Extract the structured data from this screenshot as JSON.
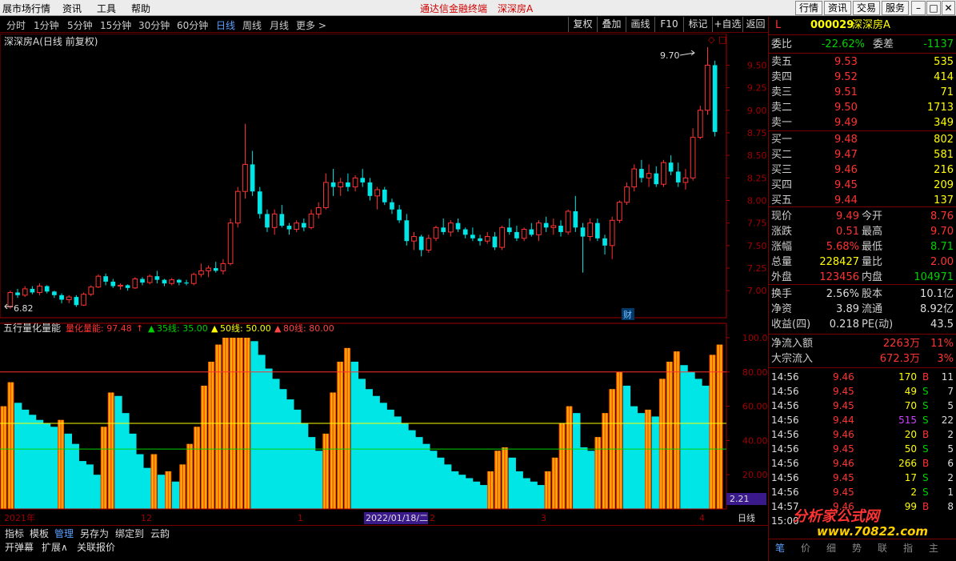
{
  "menubar": {
    "market_label": "展市场行情",
    "info_label": "资讯",
    "tools_label": "工具",
    "help_label": "帮助",
    "app_title": "通达信金融终端",
    "stock_title": "深深房A",
    "quote_btn": "行情",
    "news_btn": "资讯",
    "trade_btn": "交易",
    "service_btn": "服务"
  },
  "periods": [
    "分时",
    "1分钟",
    "5分钟",
    "15分钟",
    "30分钟",
    "60分钟",
    "日线",
    "周线",
    "月线",
    "更多 >"
  ],
  "toolbar": [
    "复权",
    "叠加",
    "画线",
    "F10",
    "标记",
    "+自选",
    "返回"
  ],
  "price_chart": {
    "title": "深深房A(日线 前复权)",
    "high_label": "9.70",
    "low_label": "6.82",
    "cai_label": "财",
    "axis_ticks": [
      "9.50",
      "9.25",
      "9.00",
      "8.75",
      "8.50",
      "8.25",
      "8.00",
      "7.75",
      "7.50",
      "7.25",
      "7.00"
    ]
  },
  "indicator": {
    "name": "五行量化量能",
    "series1": "量化量能: 97.48",
    "series2": "35线: 35.00",
    "series3": "50线: 50.00",
    "series4": "80线: 80.00",
    "axis_ticks": [
      "100.00",
      "80.00",
      "60.00",
      "40.00",
      "20.00"
    ],
    "cursor_value": "2.21"
  },
  "date_axis": {
    "year_label": "2021年",
    "m12": "12",
    "m1": "1",
    "date_box": "2022/01/18/二",
    "m2": "2",
    "m3": "3",
    "m4": "4",
    "period_label": "日线"
  },
  "quote": {
    "prefix": "L",
    "code": "000029",
    "name": "深深房A",
    "wb_label": "委比",
    "wb_value": "-22.62%",
    "wc_label": "委差",
    "wc_value": "-1137",
    "asks": [
      {
        "label": "卖五",
        "price": "9.53",
        "vol": "535"
      },
      {
        "label": "卖四",
        "price": "9.52",
        "vol": "414"
      },
      {
        "label": "卖三",
        "price": "9.51",
        "vol": "71"
      },
      {
        "label": "卖二",
        "price": "9.50",
        "vol": "1713"
      },
      {
        "label": "卖一",
        "price": "9.49",
        "vol": "349"
      }
    ],
    "bids": [
      {
        "label": "买一",
        "price": "9.48",
        "vol": "802"
      },
      {
        "label": "买二",
        "price": "9.47",
        "vol": "581"
      },
      {
        "label": "买三",
        "price": "9.46",
        "vol": "216"
      },
      {
        "label": "买四",
        "price": "9.45",
        "vol": "209"
      },
      {
        "label": "买五",
        "price": "9.44",
        "vol": "137"
      }
    ],
    "stats": [
      {
        "l1": "现价",
        "v1": "9.49",
        "l2": "今开",
        "v2": "8.76"
      },
      {
        "l1": "涨跌",
        "v1": "0.51",
        "l2": "最高",
        "v2": "9.70"
      },
      {
        "l1": "涨幅",
        "v1": "5.68%",
        "l2": "最低",
        "v2": "8.71"
      },
      {
        "l1": "总量",
        "v1": "228427",
        "l2": "量比",
        "v2": "2.00"
      },
      {
        "l1": "外盘",
        "v1": "123456",
        "l2": "内盘",
        "v2": "104971"
      }
    ],
    "stats2": [
      {
        "l1": "换手",
        "v1": "2.56%",
        "l2": "股本",
        "v2": "10.1亿"
      },
      {
        "l1": "净资",
        "v1": "3.89",
        "l2": "流通",
        "v2": "8.92亿"
      },
      {
        "l1": "收益(四)",
        "v1": "0.218",
        "l2": "PE(动)",
        "v2": "43.5"
      }
    ],
    "flow": [
      {
        "l": "净流入额",
        "v": "2263万",
        "p": "11%"
      },
      {
        "l": "大宗流入",
        "v": "672.3万",
        "p": "3%"
      }
    ],
    "ticks": [
      {
        "t": "14:56",
        "p": "9.46",
        "v": "170",
        "d": "B",
        "n": "11"
      },
      {
        "t": "14:56",
        "p": "9.45",
        "v": "49",
        "d": "S",
        "n": "7"
      },
      {
        "t": "14:56",
        "p": "9.45",
        "v": "70",
        "d": "S",
        "n": "5"
      },
      {
        "t": "14:56",
        "p": "9.44",
        "v": "515",
        "d": "S",
        "n": "22"
      },
      {
        "t": "14:56",
        "p": "9.46",
        "v": "20",
        "d": "B",
        "n": "2"
      },
      {
        "t": "14:56",
        "p": "9.45",
        "v": "50",
        "d": "S",
        "n": "5"
      },
      {
        "t": "14:56",
        "p": "9.46",
        "v": "266",
        "d": "B",
        "n": "6"
      },
      {
        "t": "14:56",
        "p": "9.45",
        "v": "17",
        "d": "S",
        "n": "2"
      },
      {
        "t": "14:56",
        "p": "9.45",
        "v": "2",
        "d": "S",
        "n": "1"
      },
      {
        "t": "14:57",
        "p": "9.46",
        "v": "99",
        "d": "B",
        "n": "8"
      },
      {
        "t": "15:00",
        "p": "",
        "v": "",
        "d": "",
        "n": ""
      }
    ],
    "bottom_tabs": [
      "笔",
      "价",
      "细",
      "势",
      "联",
      "指",
      "主"
    ]
  },
  "bottom": {
    "row1": [
      "指标",
      "模板",
      "管理",
      "另存为",
      "绑定到",
      "云韵"
    ],
    "row2": [
      "开弹幕",
      "扩展∧",
      "关联报价"
    ]
  },
  "watermark": {
    "text1": "分析家公式网",
    "text2": "www.70822.com"
  },
  "colors": {
    "up": "#ff3333",
    "down": "#00e5e5",
    "yellow": "#ffff00",
    "green": "#00d000",
    "axis": "#a00000"
  },
  "chart_data": [
    {
      "type": "candlestick",
      "title": "深深房A(日线 前复权)",
      "ylim": [
        6.7,
        9.85
      ],
      "marked_high": 9.7,
      "marked_low": 6.82,
      "values": [
        [
          6.82,
          7.0,
          6.8,
          6.98
        ],
        [
          6.98,
          7.02,
          6.92,
          6.95
        ],
        [
          6.95,
          7.05,
          6.93,
          7.02
        ],
        [
          7.02,
          7.05,
          6.96,
          6.98
        ],
        [
          6.98,
          7.08,
          6.95,
          7.05
        ],
        [
          7.05,
          7.06,
          6.97,
          6.99
        ],
        [
          6.99,
          7.0,
          6.92,
          6.95
        ],
        [
          6.95,
          6.97,
          6.86,
          6.9
        ],
        [
          6.9,
          6.95,
          6.86,
          6.93
        ],
        [
          6.93,
          6.95,
          6.82,
          6.84
        ],
        [
          6.84,
          6.98,
          6.83,
          6.96
        ],
        [
          6.96,
          7.06,
          6.94,
          7.04
        ],
        [
          7.04,
          7.18,
          7.03,
          7.16
        ],
        [
          7.16,
          7.19,
          7.06,
          7.1
        ],
        [
          7.1,
          7.13,
          7.03,
          7.05
        ],
        [
          7.05,
          7.08,
          7.01,
          7.06
        ],
        [
          7.06,
          7.07,
          7.0,
          7.03
        ],
        [
          7.03,
          7.15,
          7.02,
          7.13
        ],
        [
          7.13,
          7.15,
          7.06,
          7.09
        ],
        [
          7.09,
          7.18,
          7.07,
          7.16
        ],
        [
          7.16,
          7.22,
          7.08,
          7.12
        ],
        [
          7.12,
          7.13,
          7.05,
          7.08
        ],
        [
          7.08,
          7.14,
          7.06,
          7.12
        ],
        [
          7.12,
          7.13,
          7.06,
          7.09
        ],
        [
          7.09,
          7.12,
          7.06,
          7.08
        ],
        [
          7.08,
          7.2,
          7.06,
          7.18
        ],
        [
          7.18,
          7.3,
          7.15,
          7.22
        ],
        [
          7.22,
          7.28,
          7.15,
          7.25
        ],
        [
          7.25,
          7.32,
          7.2,
          7.22
        ],
        [
          7.22,
          7.35,
          7.18,
          7.3
        ],
        [
          7.3,
          7.8,
          7.28,
          7.75
        ],
        [
          7.75,
          8.15,
          7.7,
          8.1
        ],
        [
          8.1,
          8.85,
          8.02,
          8.4
        ],
        [
          8.4,
          8.55,
          8.05,
          8.1
        ],
        [
          8.1,
          8.15,
          7.8,
          7.85
        ],
        [
          7.85,
          7.9,
          7.65,
          7.7
        ],
        [
          7.7,
          7.9,
          7.62,
          7.85
        ],
        [
          7.85,
          7.95,
          7.7,
          7.72
        ],
        [
          7.72,
          7.75,
          7.62,
          7.68
        ],
        [
          7.68,
          7.78,
          7.65,
          7.75
        ],
        [
          7.75,
          7.8,
          7.66,
          7.7
        ],
        [
          7.7,
          7.9,
          7.68,
          7.85
        ],
        [
          7.85,
          7.98,
          7.8,
          7.92
        ],
        [
          7.92,
          8.3,
          7.9,
          8.2
        ],
        [
          8.2,
          8.35,
          8.05,
          8.15
        ],
        [
          8.15,
          8.25,
          8.05,
          8.2
        ],
        [
          8.2,
          8.3,
          8.1,
          8.15
        ],
        [
          8.15,
          8.28,
          8.1,
          8.25
        ],
        [
          8.25,
          8.35,
          8.15,
          8.2
        ],
        [
          8.2,
          8.25,
          8.0,
          8.05
        ],
        [
          8.05,
          8.15,
          7.9,
          8.12
        ],
        [
          8.12,
          8.15,
          7.95,
          7.98
        ],
        [
          7.98,
          8.02,
          7.85,
          7.9
        ],
        [
          7.9,
          7.95,
          7.75,
          7.78
        ],
        [
          7.78,
          7.85,
          7.5,
          7.55
        ],
        [
          7.55,
          7.65,
          7.45,
          7.6
        ],
        [
          7.6,
          7.62,
          7.38,
          7.45
        ],
        [
          7.45,
          7.62,
          7.42,
          7.58
        ],
        [
          7.58,
          7.72,
          7.55,
          7.7
        ],
        [
          7.7,
          7.8,
          7.62,
          7.65
        ],
        [
          7.65,
          7.78,
          7.6,
          7.75
        ],
        [
          7.75,
          7.8,
          7.65,
          7.68
        ],
        [
          7.68,
          7.7,
          7.58,
          7.62
        ],
        [
          7.62,
          7.7,
          7.55,
          7.58
        ],
        [
          7.58,
          7.62,
          7.5,
          7.55
        ],
        [
          7.55,
          7.65,
          7.52,
          7.6
        ],
        [
          7.6,
          7.65,
          7.45,
          7.48
        ],
        [
          7.48,
          7.72,
          7.45,
          7.7
        ],
        [
          7.7,
          7.8,
          7.62,
          7.65
        ],
        [
          7.65,
          7.72,
          7.55,
          7.58
        ],
        [
          7.58,
          7.7,
          7.55,
          7.68
        ],
        [
          7.68,
          7.75,
          7.6,
          7.62
        ],
        [
          7.62,
          7.78,
          7.55,
          7.75
        ],
        [
          7.75,
          7.82,
          7.65,
          7.7
        ],
        [
          7.7,
          7.8,
          7.62,
          7.72
        ],
        [
          7.72,
          7.78,
          7.6,
          7.65
        ],
        [
          7.65,
          7.9,
          7.62,
          7.88
        ],
        [
          7.88,
          8.05,
          7.65,
          7.7
        ],
        [
          7.7,
          7.75,
          7.2,
          7.6
        ],
        [
          7.6,
          7.8,
          7.55,
          7.75
        ],
        [
          7.75,
          7.8,
          7.55,
          7.58
        ],
        [
          7.58,
          7.62,
          7.4,
          7.5
        ],
        [
          7.5,
          7.82,
          7.35,
          7.78
        ],
        [
          7.78,
          8.0,
          7.75,
          7.98
        ],
        [
          7.98,
          8.2,
          7.95,
          8.15
        ],
        [
          8.15,
          8.4,
          8.1,
          8.35
        ],
        [
          8.35,
          8.45,
          8.2,
          8.25
        ],
        [
          8.25,
          8.4,
          8.15,
          8.3
        ],
        [
          8.3,
          8.38,
          8.15,
          8.18
        ],
        [
          8.18,
          8.45,
          8.15,
          8.42
        ],
        [
          8.42,
          8.5,
          8.28,
          8.32
        ],
        [
          8.32,
          8.42,
          8.15,
          8.2
        ],
        [
          8.2,
          8.35,
          8.12,
          8.25
        ],
        [
          8.25,
          8.8,
          8.22,
          8.7
        ],
        [
          8.7,
          9.05,
          8.68,
          9.0
        ],
        [
          9.0,
          9.7,
          8.95,
          9.5
        ],
        [
          9.5,
          9.55,
          8.71,
          8.76
        ]
      ]
    },
    {
      "type": "bar",
      "title": "五行量化量能",
      "ylim": [
        0,
        100
      ],
      "reference_lines": [
        35,
        50,
        80
      ],
      "values": [
        60,
        74,
        62,
        58,
        55,
        52,
        50,
        48,
        52,
        44,
        38,
        28,
        26,
        20,
        48,
        68,
        66,
        56,
        44,
        32,
        24,
        32,
        20,
        22,
        16,
        26,
        38,
        48,
        72,
        86,
        96,
        100,
        100,
        100,
        100,
        98,
        90,
        82,
        76,
        70,
        64,
        58,
        50,
        42,
        34,
        44,
        68,
        86,
        94,
        86,
        76,
        70,
        66,
        62,
        58,
        54,
        50,
        46,
        42,
        38,
        34,
        30,
        26,
        22,
        20,
        18,
        16,
        14,
        22,
        34,
        36,
        30,
        22,
        18,
        16,
        14,
        22,
        30,
        50,
        60,
        56,
        36,
        34,
        42,
        56,
        70,
        80,
        72,
        60,
        56,
        58,
        54,
        76,
        86,
        92,
        84,
        80,
        76,
        72,
        90,
        96
      ]
    }
  ]
}
